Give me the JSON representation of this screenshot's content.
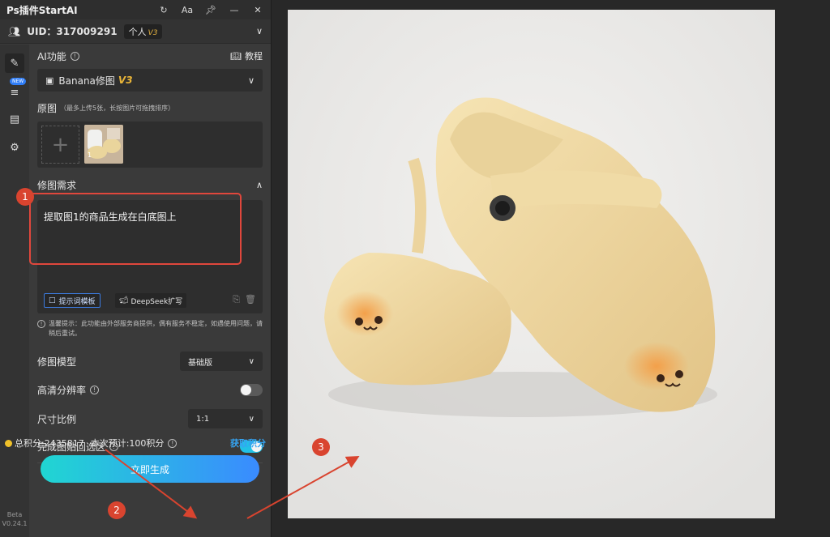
{
  "app": {
    "title": "Ps插件StartAI",
    "titlebar_icons": [
      "refresh-icon",
      "font-size-icon",
      "pin-icon",
      "minimize-icon",
      "close-icon"
    ]
  },
  "user": {
    "uid": "UID：317009291",
    "plan": "个人",
    "plan_version": "V3"
  },
  "sidebar": {
    "new_badge": "NEW",
    "version_line1": "Beta",
    "version_line2": "V0.24.1"
  },
  "ai_function": {
    "label": "AI功能",
    "tutorial": "教程",
    "selected": "Banana修图",
    "selected_version": "V3"
  },
  "source": {
    "label": "原图",
    "note": "（最多上传5张，长按图片可拖拽排序）",
    "add_symbol": "+",
    "thumb_index": "1"
  },
  "requirement": {
    "label": "修图需求",
    "text": "提取图1的商品生成在白底图上",
    "chip_template": "提示词模板",
    "chip_deepseek": "DeepSeek扩写",
    "hint": "温馨提示：此功能由外部服务商提供，偶有服务不稳定，如遇使用问题，请稍后重试。"
  },
  "settings": {
    "model_label": "修图模型",
    "model_value": "基础版",
    "hd_label": "高清分辨率",
    "hd_on": false,
    "ratio_label": "尺寸比例",
    "ratio_value": "1:1",
    "paste_label": "完成图贴回选区",
    "paste_on": true
  },
  "footer": {
    "points": "总积分:2435817",
    "cost": "本次预计:100积分",
    "get_points": "获取积分",
    "generate": "立即生成"
  },
  "annotations": [
    "1",
    "2",
    "3"
  ],
  "colors": {
    "accent": "#21c1e6",
    "gen_start": "#20d6d2",
    "gen_end": "#3a8bff",
    "annotation": "#d9442f",
    "version_gold": "#e9b538"
  }
}
